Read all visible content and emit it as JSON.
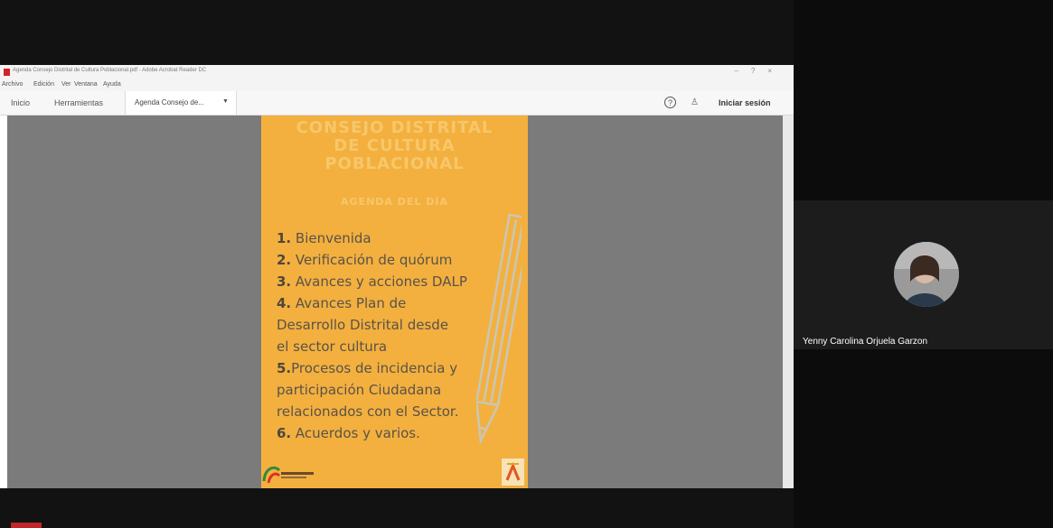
{
  "acrobat": {
    "window_title": "Agenda Consejo Distrital de Cultura Poblacional.pdf - Adobe Acrobat Reader DC",
    "menu": [
      "Archivo",
      "Edición",
      "Ver",
      "Ventana",
      "Ayuda"
    ],
    "tabs": {
      "home": "Inicio",
      "tools": "Herramientas",
      "document": "Agenda Consejo de..."
    },
    "sign_in": "Iniciar sesión"
  },
  "slide": {
    "title_lines": [
      "CONSEJO DISTRITAL",
      "DE CULTURA",
      "POBLACIONAL"
    ],
    "subtitle": "AGENDA DEL DÍA",
    "agenda": [
      {
        "num": "1.",
        "text": " Bienvenida"
      },
      {
        "num": "2.",
        "text": " Verificación de quórum"
      },
      {
        "num": "3.",
        "text": " Avances y acciones DALP"
      },
      {
        "num": "4.",
        "text": " Avances Plan  de"
      },
      {
        "num": "",
        "text": "Desarrollo  Distrital desde"
      },
      {
        "num": "",
        "text": "el sector cultura"
      },
      {
        "num": "5.",
        "text": "Procesos de incidencia y"
      },
      {
        "num": "",
        "text": "participación Ciudadana"
      },
      {
        "num": "",
        "text": "relacionados con el Sector."
      },
      {
        "num": "6.",
        "text": " Acuerdos y varios."
      }
    ]
  },
  "participant": {
    "name": "Yenny Carolina Orjuela Garzon"
  },
  "colors": {
    "slide_bg": "#f3b03f",
    "viewer_bg": "#7b7b7b",
    "meeting_bg": "#121212"
  },
  "icons": [
    "help-icon",
    "bell-icon",
    "pencil-icon",
    "avatar"
  ]
}
